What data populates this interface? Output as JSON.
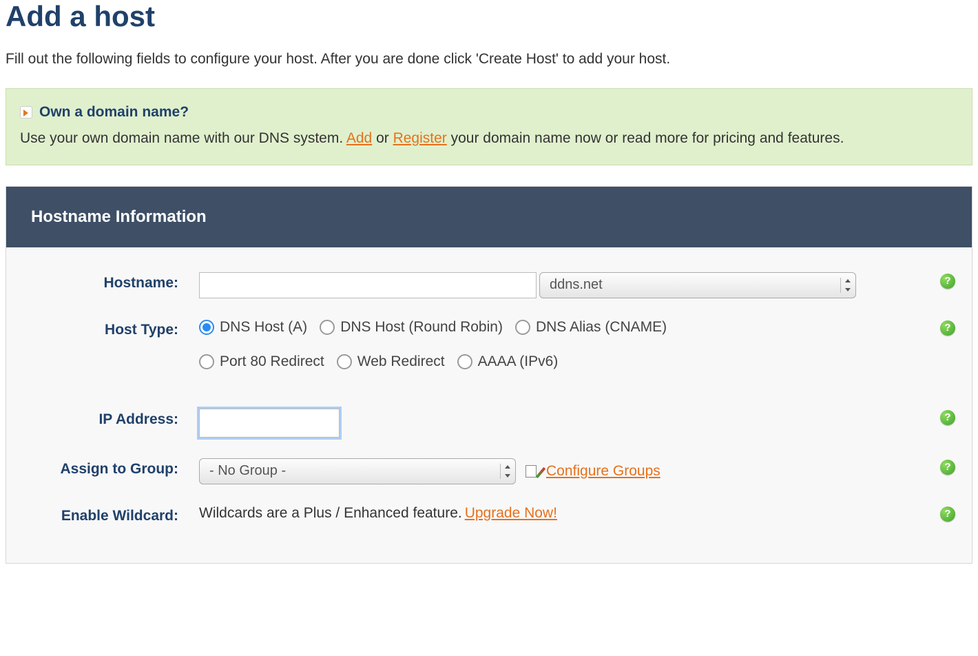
{
  "page": {
    "title": "Add a host",
    "description": "Fill out the following fields to configure your host. After you are done click 'Create Host' to add your host."
  },
  "infoBox": {
    "heading": "Own a domain name?",
    "text_pre": "Use your own domain name with our DNS system. ",
    "link_add": "Add",
    "text_or": " or ",
    "link_register": "Register",
    "text_post": " your domain name now or read more for pricing and features."
  },
  "panel": {
    "header": "Hostname Information"
  },
  "labels": {
    "hostname": "Hostname:",
    "hosttype": "Host Type:",
    "ip": "IP Address:",
    "group": "Assign to Group:",
    "wildcard": "Enable Wildcard:"
  },
  "hostname": {
    "value": "",
    "domain_selected": "ddns.net"
  },
  "hosttype": {
    "opt1": "DNS Host (A)",
    "opt2": "DNS Host (Round Robin)",
    "opt3": "DNS Alias (CNAME)",
    "opt4": "Port 80 Redirect",
    "opt5": "Web Redirect",
    "opt6": "AAAA (IPv6)"
  },
  "ip": {
    "value": ""
  },
  "group": {
    "selected": "- No Group -",
    "configure_link": "Configure Groups"
  },
  "wildcard": {
    "text": "Wildcards are a Plus / Enhanced feature. ",
    "upgrade_link": "Upgrade Now!"
  }
}
